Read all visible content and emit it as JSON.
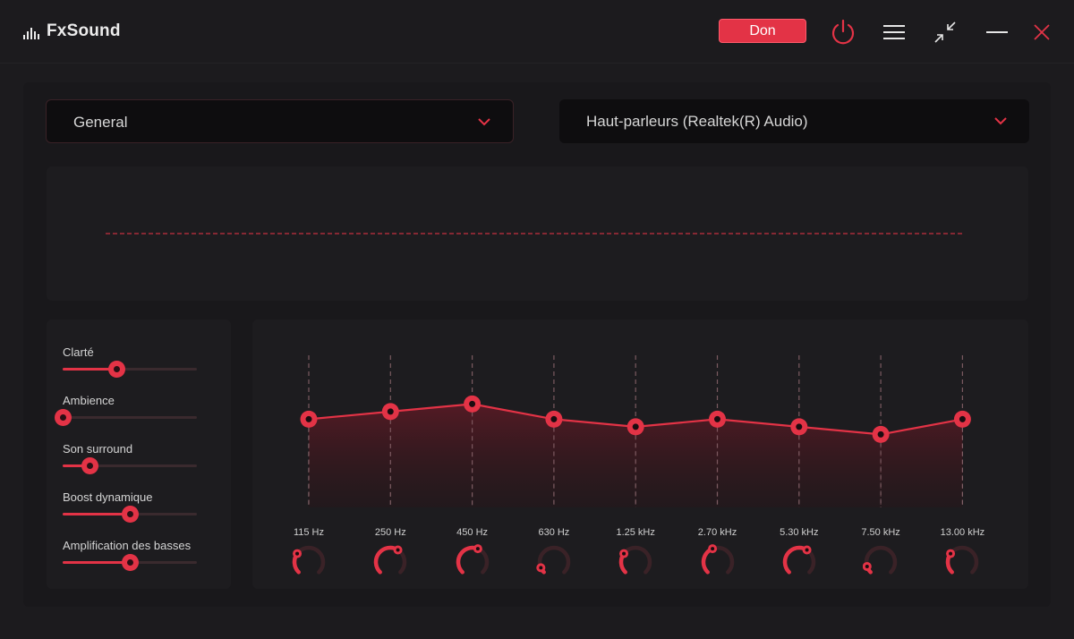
{
  "app": {
    "title": "FxSound"
  },
  "titlebar": {
    "donate_label": "Don",
    "icons": [
      "power-icon",
      "menu-icon",
      "minimize-to-mini-icon",
      "minimize-icon",
      "close-icon"
    ]
  },
  "preset": {
    "selected": "General"
  },
  "output_device": {
    "selected": "Haut-parleurs (Realtek(R) Audio)"
  },
  "effects": [
    {
      "label": "Clarté",
      "value": 0.4
    },
    {
      "label": "Ambience",
      "value": 0.0
    },
    {
      "label": "Son surround",
      "value": 0.2
    },
    {
      "label": "Boost dynamique",
      "value": 0.5
    },
    {
      "label": "Amplification des basses",
      "value": 0.5
    }
  ],
  "equalizer": {
    "bands": [
      {
        "label": "115 Hz",
        "level": 0.58,
        "knob": 0.3
      },
      {
        "label": "250 Hz",
        "level": 0.63,
        "knob": 0.62
      },
      {
        "label": "450 Hz",
        "level": 0.68,
        "knob": 0.58
      },
      {
        "label": "630 Hz",
        "level": 0.58,
        "knob": 0.08
      },
      {
        "label": "1.25 kHz",
        "level": 0.53,
        "knob": 0.3
      },
      {
        "label": "2.70 kHz",
        "level": 0.58,
        "knob": 0.42
      },
      {
        "label": "5.30 kHz",
        "level": 0.53,
        "knob": 0.62
      },
      {
        "label": "7.50 kHz",
        "level": 0.48,
        "knob": 0.1
      },
      {
        "label": "13.00 kHz",
        "level": 0.58,
        "knob": 0.3
      }
    ]
  },
  "colors": {
    "accent": "#e33346",
    "background": "#1c1b1e",
    "panel": "#1d1c1f",
    "dropdown": "#0e0d0f",
    "track": "#3a2a2e"
  }
}
